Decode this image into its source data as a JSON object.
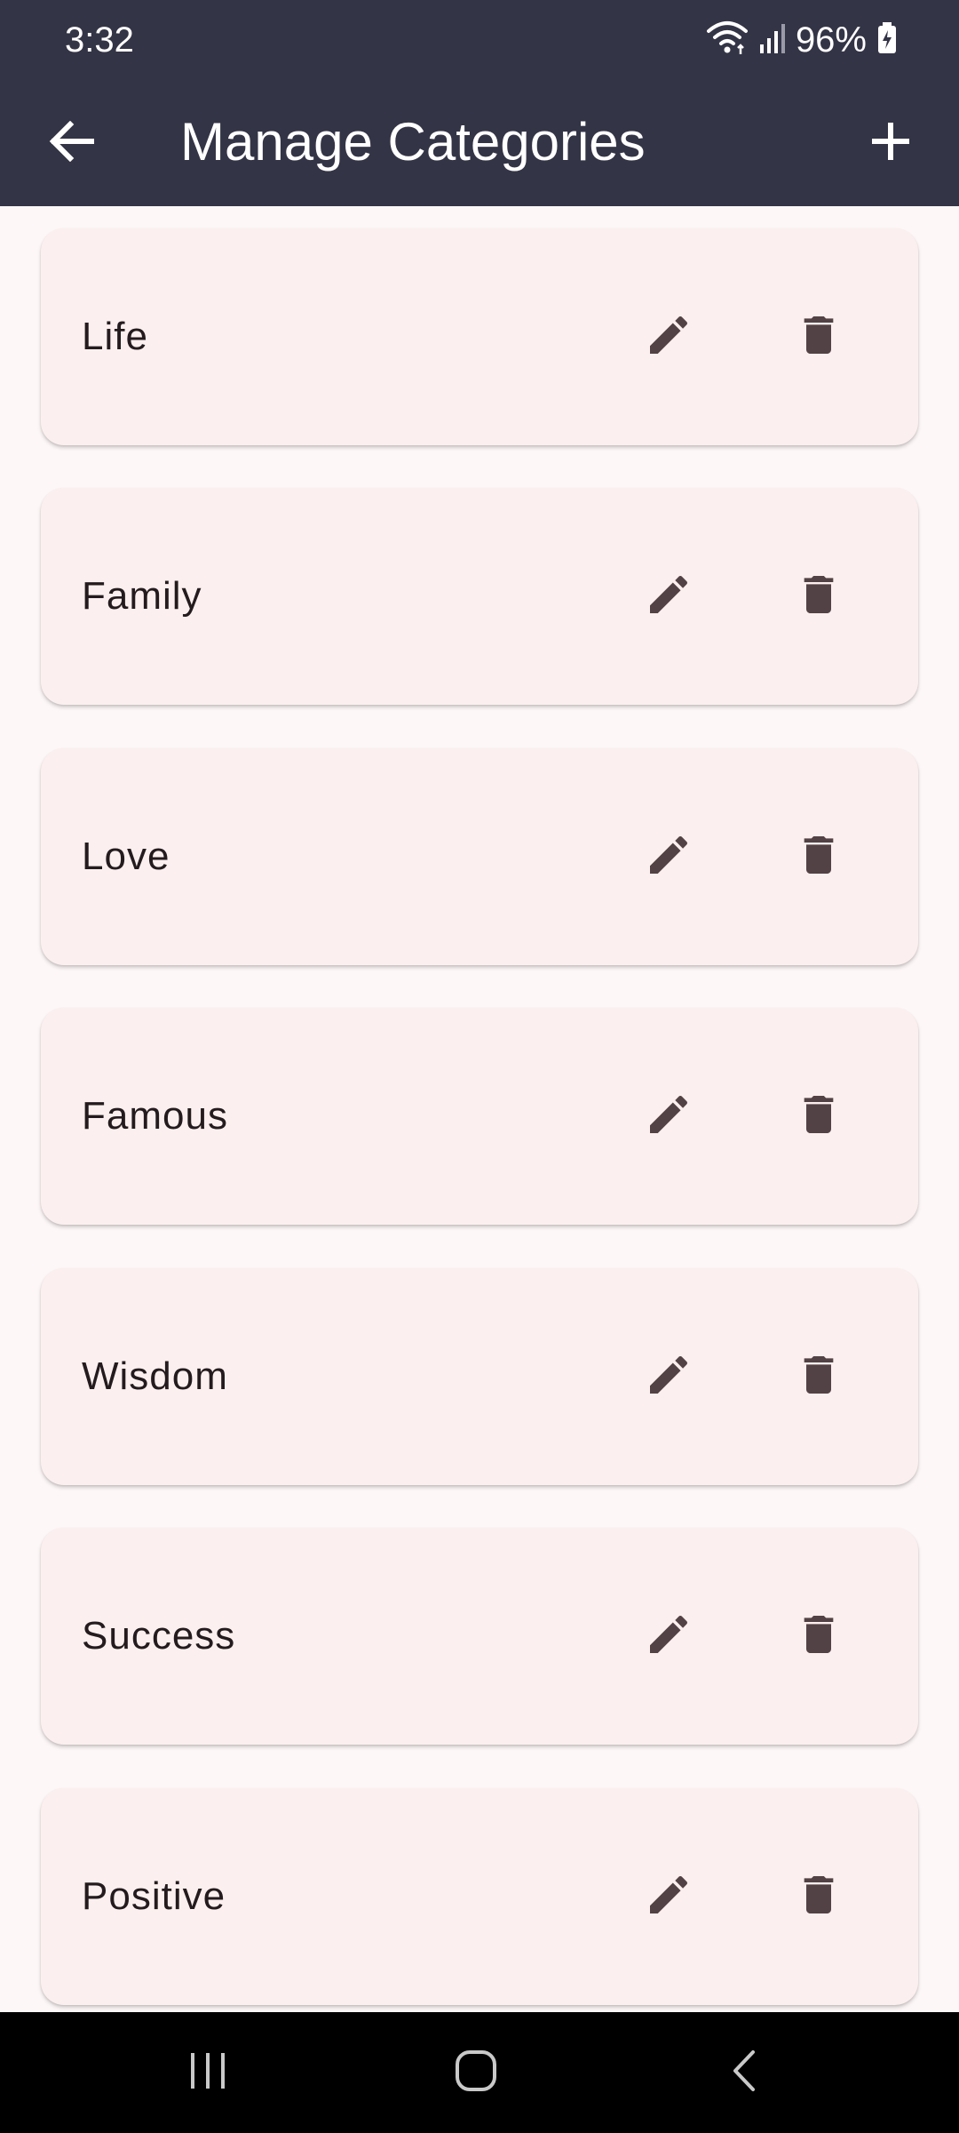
{
  "status_bar": {
    "time": "3:32",
    "battery": "96%",
    "icons": [
      "wifi-icon",
      "signal-icon",
      "battery-charging-icon"
    ]
  },
  "app_bar": {
    "title": "Manage Categories",
    "back_icon": "arrow-left-icon",
    "add_icon": "plus-icon"
  },
  "categories": [
    {
      "label": "Life"
    },
    {
      "label": "Family"
    },
    {
      "label": "Love"
    },
    {
      "label": "Famous"
    },
    {
      "label": "Wisdom"
    },
    {
      "label": "Success"
    },
    {
      "label": "Positive"
    }
  ],
  "row_actions": {
    "edit_icon": "pencil-icon",
    "delete_icon": "trash-icon"
  },
  "nav_bar": {
    "icons": [
      "recent-apps-icon",
      "home-icon",
      "back-icon"
    ]
  },
  "colors": {
    "app_bar": "#343447",
    "background": "#fdf7f7",
    "card": "#fcefef",
    "icon": "#524245",
    "text": "#231b1d"
  }
}
